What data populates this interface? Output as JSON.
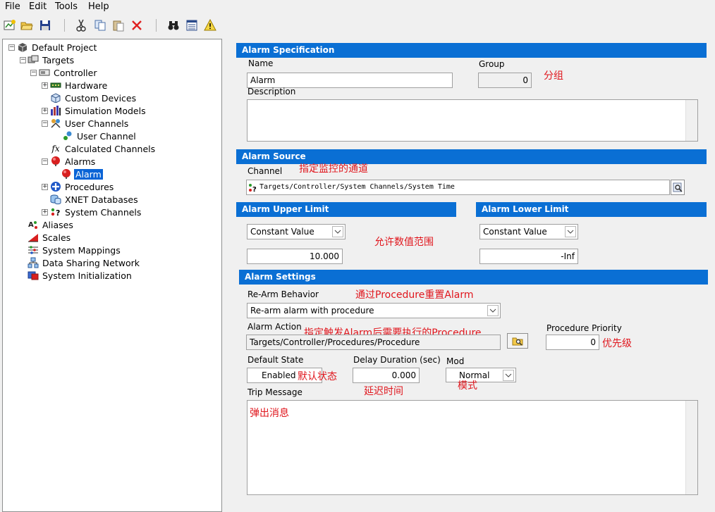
{
  "menu": {
    "file": "File",
    "edit": "Edit",
    "tools": "Tools",
    "help": "Help"
  },
  "tree": {
    "root": "Default Project",
    "targets": "Targets",
    "controller": "Controller",
    "hardware": "Hardware",
    "custom_devices": "Custom Devices",
    "simulation_models": "Simulation Models",
    "user_channels": "User Channels",
    "user_channel": "User Channel",
    "calculated_channels": "Calculated Channels",
    "alarms": "Alarms",
    "alarm": "Alarm",
    "procedures": "Procedures",
    "xnet_databases": "XNET Databases",
    "system_channels": "System Channels",
    "aliases": "Aliases",
    "scales": "Scales",
    "system_mappings": "System Mappings",
    "data_sharing_network": "Data Sharing Network",
    "system_initialization": "System Initialization"
  },
  "spec": {
    "header": "Alarm Specification",
    "name_label": "Name",
    "name_value": "Alarm",
    "group_label": "Group",
    "group_value": "0",
    "description_label": "Description",
    "description_value": ""
  },
  "source": {
    "header": "Alarm Source",
    "channel_label": "Channel",
    "channel_value": "Targets/Controller/System Channels/System Time"
  },
  "upper": {
    "header": "Alarm Upper Limit",
    "mode": "Constant Value",
    "value": "10.000"
  },
  "lower": {
    "header": "Alarm Lower Limit",
    "mode": "Constant Value",
    "value": "-Inf"
  },
  "settings": {
    "header": "Alarm Settings",
    "rearm_label": "Re-Arm Behavior",
    "rearm_value": "Re-arm alarm with procedure",
    "action_label": "Alarm Action",
    "action_value": "Targets/Controller/Procedures/Procedure",
    "priority_label": "Procedure Priority",
    "priority_value": "0",
    "default_state_label": "Default State",
    "default_state_value": "Enabled",
    "delay_label": "Delay Duration (sec)",
    "delay_value": "0.000",
    "mode_label": "Mod",
    "mode_value": "Normal",
    "trip_label": "Trip Message",
    "trip_value": ""
  },
  "annotations": {
    "group": "分组",
    "channel": "指定监控的通道",
    "limits": "允许数值范围",
    "rearm": "通过Procedure重置Alarm",
    "action": "指定触发Alarm后需要执行的Procedure",
    "priority": "优先级",
    "default_state": "默认状态",
    "delay": "延迟时间",
    "mode": "模式",
    "trip": "弹出消息"
  },
  "colors": {
    "section_header": "#0a6fd4",
    "annotation": "#e0161d",
    "selection": "#0a64d6"
  }
}
